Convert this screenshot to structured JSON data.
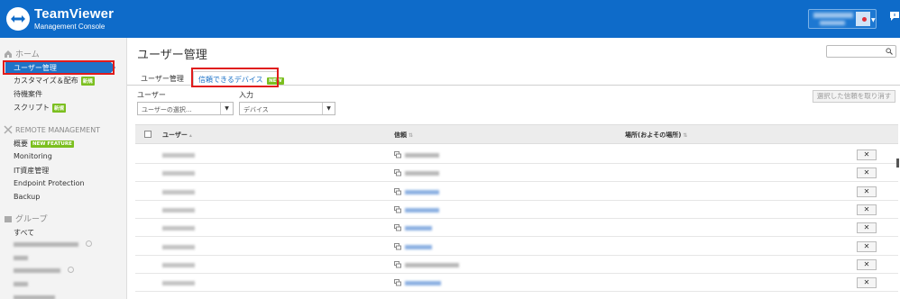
{
  "header": {
    "brand": "TeamViewer",
    "subtitle": "Management Console",
    "logo_icon": "teamviewer-arrows-icon",
    "chat_icon": "chat-icon"
  },
  "sidebar": {
    "home_label": "ホーム",
    "home_items": [
      {
        "label": "ユーザー管理",
        "active": true
      },
      {
        "label": "カスタマイズ＆配布",
        "badge": "新規"
      },
      {
        "label": "待機案件"
      },
      {
        "label": "スクリプト",
        "badge": "新規"
      }
    ],
    "remote_label": "REMOTE MANAGEMENT",
    "remote_items": [
      {
        "label": "概要",
        "badge": "NEW FEATURE"
      },
      {
        "label": "Monitoring"
      },
      {
        "label": "IT資産管理"
      },
      {
        "label": "Endpoint Protection"
      },
      {
        "label": "Backup"
      }
    ],
    "group_label": "グループ",
    "group_items": [
      {
        "label": "すべて"
      }
    ]
  },
  "main": {
    "title": "ユーザー管理",
    "search_placeholder": "",
    "tabs": [
      {
        "label": "ユーザー管理"
      },
      {
        "label": "信頼できるデバイス",
        "badge": "NEW",
        "active": true
      }
    ],
    "filters": {
      "user_label": "ユーザー",
      "user_value": "ユーザーの選択...",
      "input_label": "入力",
      "input_value": "デバイス"
    },
    "revoke_button": "選択した信頼を取り消す",
    "table": {
      "columns": [
        "ユーザー",
        "信頼",
        "場所(およその場所)"
      ],
      "remove_glyph": "✕",
      "rows": 8
    }
  },
  "colors": {
    "header_bg": "#0e6bc9",
    "active_item": "#1e73c8",
    "badge_green": "#7bbf1f",
    "highlight_red": "#e01b1b"
  }
}
